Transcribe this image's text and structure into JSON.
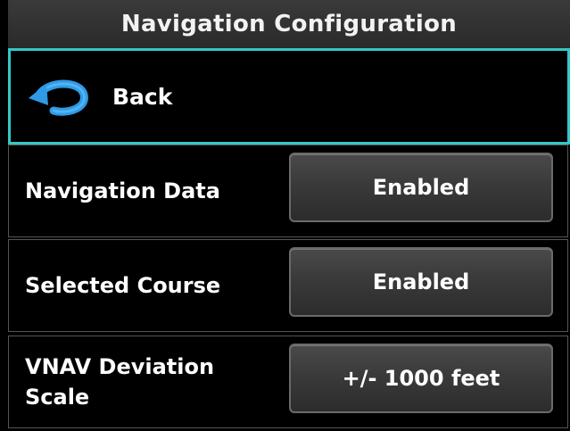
{
  "title": "Navigation Configuration",
  "back": {
    "label": "Back"
  },
  "settings": [
    {
      "label": "Navigation Data",
      "value": "Enabled"
    },
    {
      "label": "Selected Course",
      "value": "Enabled"
    },
    {
      "label": "VNAV Deviation Scale",
      "value": "+/- 1000 feet"
    }
  ],
  "colors": {
    "selection_border": "#35c7c7",
    "back_icon": "#2f9be6",
    "background": "#000000",
    "button_fill": "#3a3a3a"
  },
  "icons": {
    "back": "back-arrow-icon"
  }
}
